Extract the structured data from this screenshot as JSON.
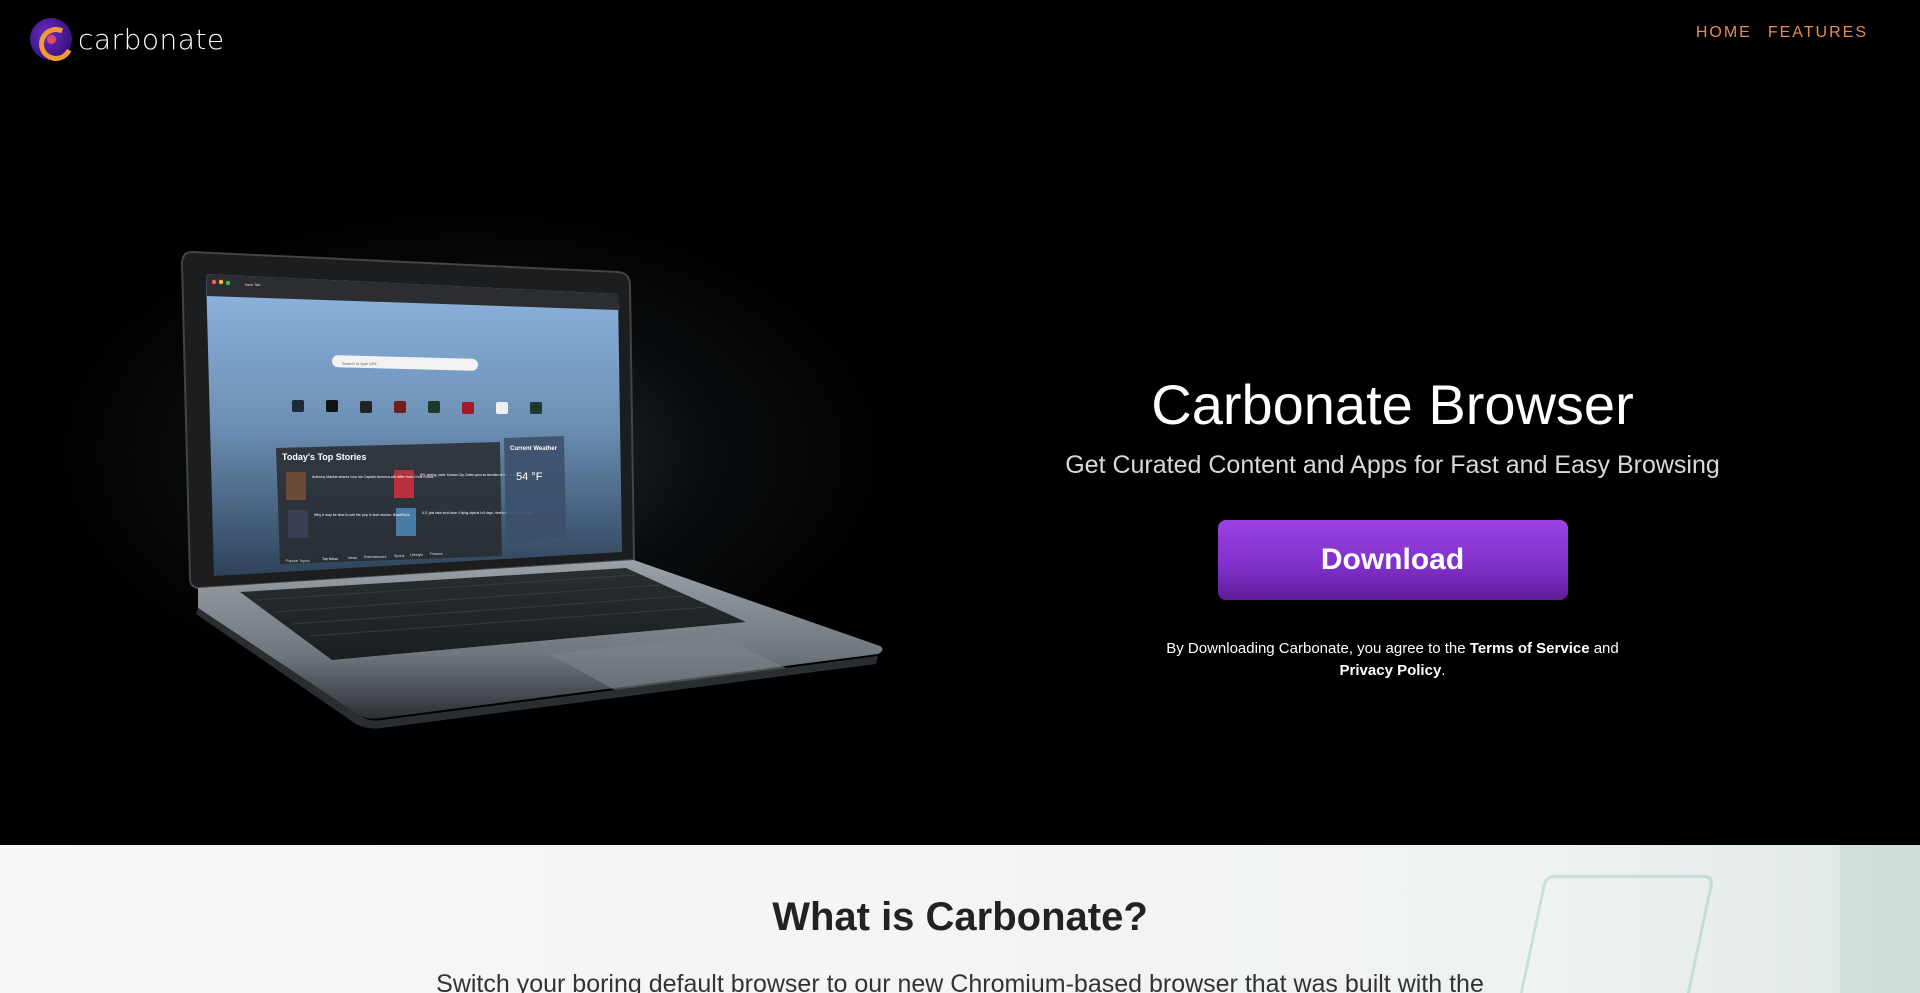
{
  "header": {
    "logo_text": "carbonate",
    "nav": [
      {
        "label": "HOME"
      },
      {
        "label": "FEATURES"
      }
    ],
    "nav_color": "#e58d4c"
  },
  "hero": {
    "title": "Carbonate Browser",
    "subtitle": "Get Curated Content and Apps for Fast and Easy Browsing",
    "download_label": "Download",
    "legal_prefix": "By Downloading Carbonate, you agree to the ",
    "terms_label": "Terms of Service",
    "legal_and": " and",
    "privacy_label": "Privacy Policy",
    "legal_suffix": ".",
    "accent": "#8b36d6"
  },
  "laptop_screen": {
    "tab_title": "New Tab",
    "search_placeholder": "Search or type URL",
    "stories_title": "Today's Top Stories",
    "weather_title": "Current Weather",
    "weather_temp": "54 °F",
    "story_1": "Anthony Mackie shares how his Captain America will differ from Chris Evans",
    "story_2": "NFL betting, odds: Kansas City Chiefs open as favorites to win Super Bowl in 2024",
    "story_3": "Why it may be time to sell the pop in tech stocks: BlackRock",
    "story_4": "U.S. jets have shot down 4 flying objects in 8 days. Here's everything we know.",
    "tabs": [
      "Popular Topics",
      "Top News",
      "News",
      "Entertainment",
      "Sports",
      "Lifestyle",
      "Finance"
    ]
  },
  "lower": {
    "title": "What is Carbonate?",
    "body": "Switch your boring default browser to our new Chromium-based browser that was built with the"
  }
}
